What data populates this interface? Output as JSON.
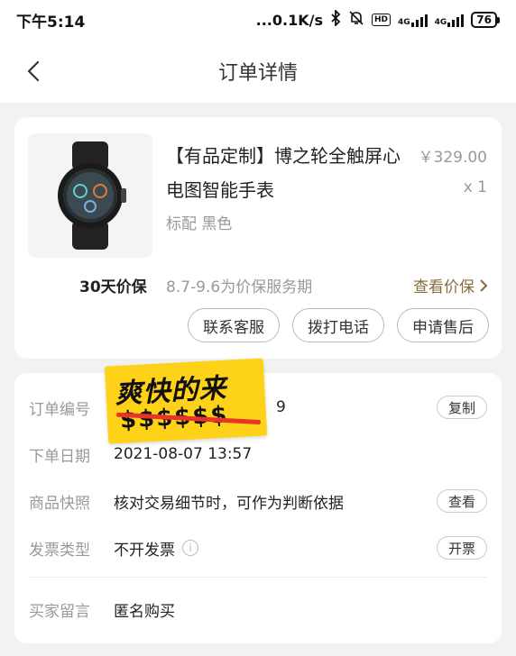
{
  "status_bar": {
    "time": "下午5:14",
    "speed": "...0.1K/s",
    "net1": "4G",
    "net2": "4G",
    "hd": "HD",
    "battery": "76"
  },
  "header": {
    "title": "订单详情"
  },
  "product": {
    "name": "【有品定制】博之轮全触屏心电图智能手表",
    "spec": "标配 黑色",
    "price": "￥329.00",
    "qty": "x 1",
    "guarantee_label": "30天价保",
    "guarantee_period": "8.7-9.6为价保服务期",
    "guarantee_link": "查看价保"
  },
  "actions": {
    "contact": "联系客服",
    "call": "拨打电话",
    "after_sale": "申请售后"
  },
  "order_info": {
    "order_no_label": "订单编号",
    "order_no_value": "9",
    "copy_btn": "复制",
    "date_label": "下单日期",
    "date_value": "2021-08-07 13:57",
    "snapshot_label": "商品快照",
    "snapshot_value": "核对交易细节时，可作为判断依据",
    "view_btn": "查看",
    "invoice_label": "发票类型",
    "invoice_value": "不开发票",
    "invoice_btn": "开票",
    "message_label": "买家留言",
    "message_value": "匿名购买"
  },
  "sticker": {
    "text": "爽快的来",
    "dollars": "$$$$$$"
  },
  "colors": {
    "accent_gold": "#8a6b3a",
    "sticker_yellow": "#ffd21a",
    "strike_red": "#e8352a"
  }
}
